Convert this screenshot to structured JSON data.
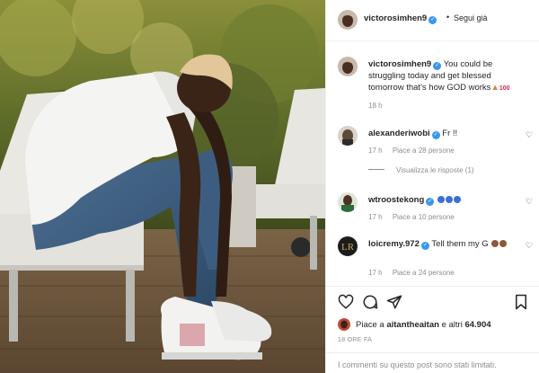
{
  "post": {
    "author": {
      "username": "victorosimhen9",
      "verified": true,
      "follow_label": "Segui già",
      "separator": "•",
      "more_label": "•••"
    },
    "caption": {
      "username": "victorosimhen9",
      "text": "You could be struggling today and get blessed tomorrow that's how GOD works",
      "emoji_icons": [
        "praying-hands-icon",
        "100-icon"
      ],
      "time": "18 h"
    },
    "comments": [
      {
        "username": "alexanderiwobi",
        "verified": true,
        "text": "Fr !!",
        "time": "17 h",
        "likes": "Piace a 28 persone",
        "avatar_color": "#5a4a3a",
        "replies_label": "Visualizza le risposte (1)"
      },
      {
        "username": "wtroostekong",
        "verified": true,
        "text": "",
        "emoji_icons": [
          "grinning-squint-icon",
          "grinning-squint-icon",
          "grinning-squint-icon"
        ],
        "time": "17 h",
        "likes": "Piace a 10 persone",
        "avatar_color": "#2e6b3a"
      },
      {
        "username": "loicremy.972",
        "verified": true,
        "text": "Tell them my G",
        "emoji_icons": [
          "punch-icon",
          "punch-icon"
        ],
        "time": "17 h",
        "likes": "Piace a 24 persone",
        "avatar_color": "#1c1c1c"
      }
    ],
    "likes_text": "Piace a aitantheaitan e altri 64.904",
    "liker_username": "aitantheaitan",
    "likes_count": "64.904",
    "post_time": "18 ORE FA",
    "comments_limited": "I commenti su questo post sono stati limitati.",
    "action_icons": [
      "heart-icon",
      "comment-icon",
      "share-icon",
      "bookmark-icon"
    ],
    "colors": {
      "verified_blue": "#3897f0",
      "meta_gray": "#8e8e8e",
      "text": "#262626",
      "border": "#efefef"
    }
  }
}
